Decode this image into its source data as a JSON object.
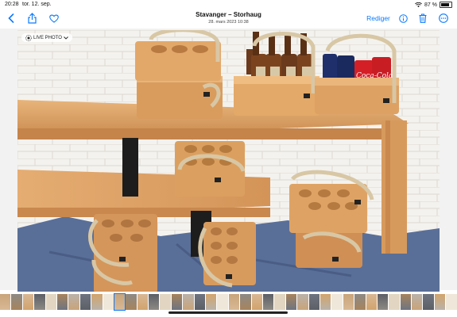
{
  "status_bar": {
    "time": "20:28",
    "date": "tor. 12. sep.",
    "battery": "87 %"
  },
  "toolbar": {
    "title": "Stavanger – Storhaug",
    "subtitle": "28. mars 2023 10:38",
    "edit_label": "Rediger"
  },
  "photo": {
    "live_label": "LIVE PHOTO",
    "bottle_label": "Coca-Cola",
    "can_label": "Coca-Cola"
  },
  "filmstrip": {
    "thumb_count": 40,
    "current_index": 10
  },
  "icons": [
    "back-icon",
    "share-icon",
    "heart-icon",
    "info-icon",
    "trash-icon",
    "more-icon",
    "live-photo-icon",
    "chevron-down-icon",
    "wifi-icon",
    "battery-icon"
  ],
  "colors": {
    "accent": "#0a7aff"
  }
}
